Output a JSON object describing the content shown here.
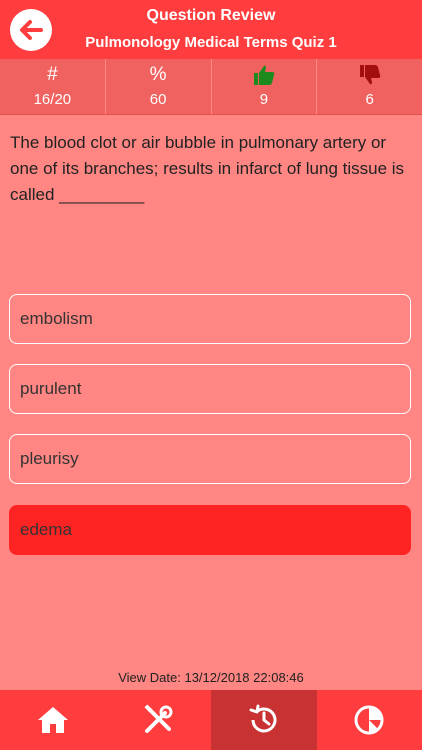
{
  "header": {
    "title": "Question Review",
    "subtitle": "Pulmonology Medical Terms Quiz 1"
  },
  "stats": [
    {
      "icon": "hash-icon",
      "symbol": "#",
      "value": "16/20"
    },
    {
      "icon": "percent-icon",
      "symbol": "%",
      "value": "60"
    },
    {
      "icon": "thumbs-up-icon",
      "symbol": "",
      "value": "9"
    },
    {
      "icon": "thumbs-down-icon",
      "symbol": "",
      "value": "6"
    }
  ],
  "question": {
    "text": "The blood clot or air bubble in pulmonary artery or one of its branches; results in infarct of lung tissue is called _________"
  },
  "answers": [
    {
      "label": "embolism",
      "state": "neutral"
    },
    {
      "label": "purulent",
      "state": "neutral"
    },
    {
      "label": "pleurisy",
      "state": "neutral"
    },
    {
      "label": "edema",
      "state": "wrong"
    }
  ],
  "footer": {
    "view_date": "View Date: 13/12/2018 22:08:46"
  },
  "tabs": [
    {
      "icon": "home-icon",
      "active": false
    },
    {
      "icon": "tools-icon",
      "active": false
    },
    {
      "icon": "history-icon",
      "active": true
    },
    {
      "icon": "pie-chart-icon",
      "active": false
    }
  ],
  "colors": {
    "header_bg": "#ff3d3e",
    "page_bg": "#ff8683",
    "stats_bg": "#f0625f",
    "wrong_answer": "#ff2424",
    "thumbs_up": "#1d8a1d",
    "thumbs_down": "#a30e0e"
  }
}
